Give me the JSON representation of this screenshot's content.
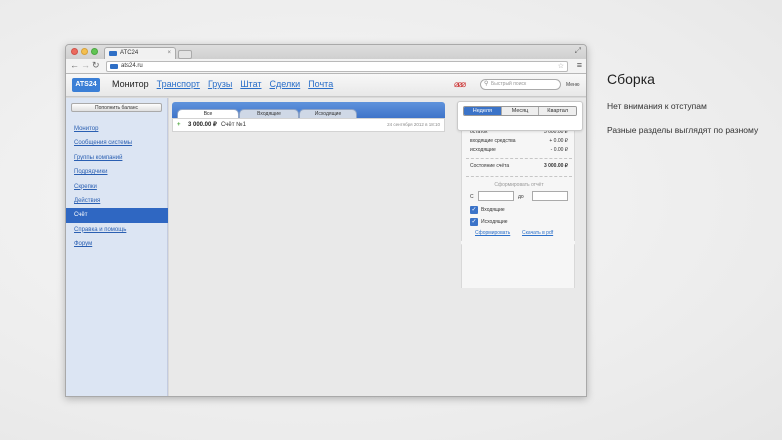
{
  "slide": {
    "title": "Сборка",
    "note1": "Нет внимания к отступам",
    "note2": "Разные разделы выглядят по разному"
  },
  "browser": {
    "tab_title": "ATC24",
    "url": "ats24.ru"
  },
  "app": {
    "logo": "ATS24",
    "nav": [
      "Монитор",
      "Транспорт",
      "Грузы",
      "Штат",
      "Сделки",
      "Почта"
    ],
    "search_placeholder": "Быстрый поиск",
    "menu_label": "Меню"
  },
  "sidebar": {
    "topup_label": "Пополнить баланс",
    "items": [
      "Монитор",
      "Сообщения системы",
      "Группы компаний",
      "Подрядчики",
      "Скрепки",
      "Действия",
      "Счёт",
      "Справка и помощь",
      "Форум"
    ],
    "active_index": 6
  },
  "main": {
    "tabs": [
      "Все",
      "Входящие",
      "Исходящие"
    ],
    "transaction": {
      "sign": "+",
      "amount": "3 000.00 ₽",
      "description": "Счёт №1",
      "date": "24 сентября 2012 в 18:10"
    }
  },
  "widget": {
    "periods": [
      "Неделя",
      "Месяц",
      "Квартал"
    ],
    "selected_period": "Неделя",
    "rows": [
      {
        "label": "остаток",
        "value": "3 000.00 ₽"
      },
      {
        "label": "входящие средства",
        "value": "+ 0.00 ₽"
      },
      {
        "label": "исходящие",
        "value": "- 0.00 ₽"
      }
    ],
    "balance_label": "Состояние счёта",
    "balance_value": "3 000.00 ₽",
    "report_label": "Сформировать отчёт",
    "from_label": "С",
    "to_label": "до",
    "check_incoming": "Входящие",
    "check_outgoing": "Исходящие",
    "generate_link": "Сформировать",
    "download_link": "Скачать в pdf"
  }
}
